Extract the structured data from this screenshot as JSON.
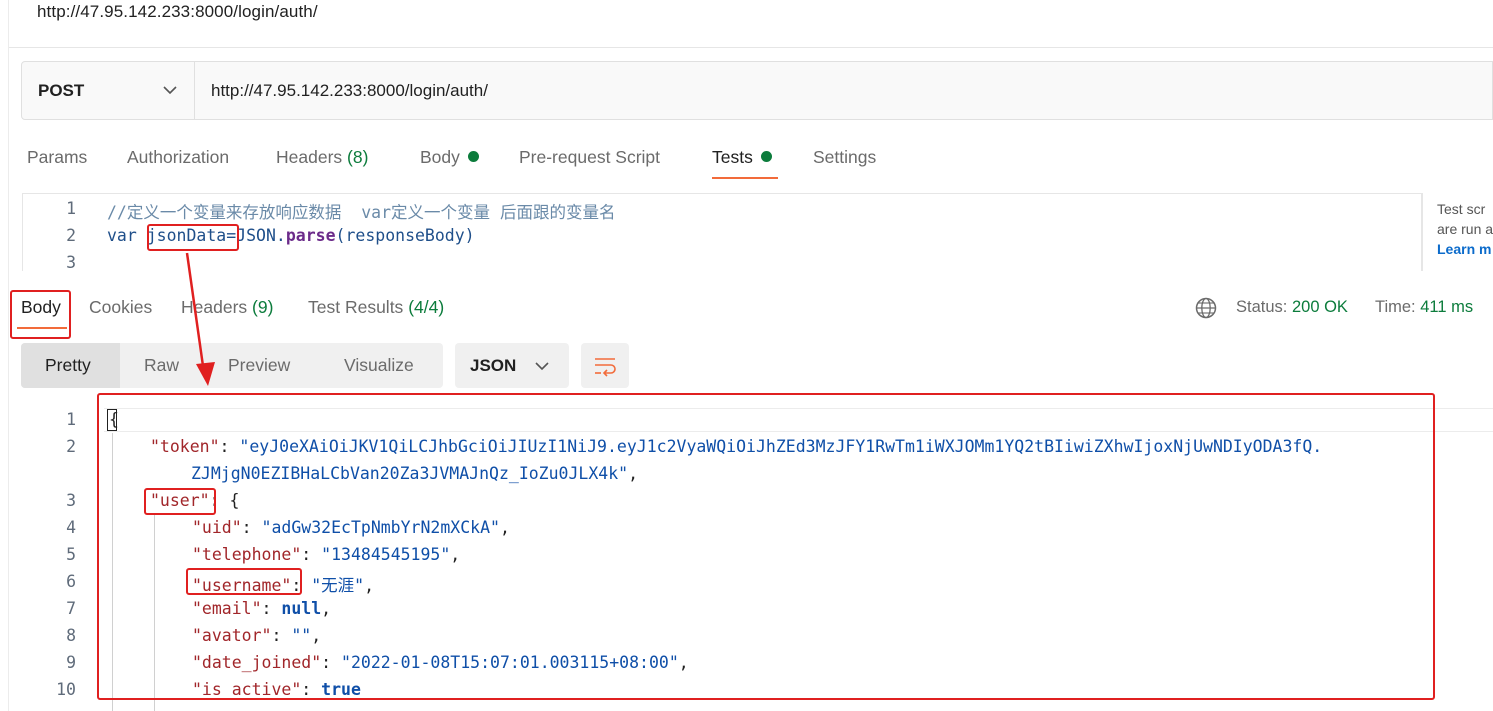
{
  "request": {
    "title": "http://47.95.142.233:8000/login/auth/",
    "method": "POST",
    "url": "http://47.95.142.233:8000/login/auth/"
  },
  "request_tabs": {
    "params": "Params",
    "authorization": "Authorization",
    "headers": "Headers",
    "headers_count": "(8)",
    "body": "Body",
    "pre_request": "Pre-request Script",
    "tests": "Tests",
    "settings": "Settings"
  },
  "script": {
    "line_numbers": [
      "1",
      "2",
      "3"
    ],
    "comment": "//定义一个变量来存放响应数据  var定义一个变量 后面跟的变量名",
    "var_kw": "var",
    "var_name": "jsonData",
    "eq": "=",
    "json_obj": "JSON",
    "dot": ".",
    "parse_fn": "parse",
    "args": "(responseBody)"
  },
  "side_hint": {
    "line1": "Test scr",
    "line2": "are run a",
    "link": "Learn m"
  },
  "response_tabs": {
    "body": "Body",
    "cookies": "Cookies",
    "headers": "Headers",
    "headers_count": "(9)",
    "test_results": "Test Results",
    "test_results_count": "(4/4)"
  },
  "status": {
    "status_label": "Status:",
    "status_value": "200 OK",
    "time_label": "Time:",
    "time_value": "411 ms"
  },
  "view_modes": {
    "pretty": "Pretty",
    "raw": "Raw",
    "preview": "Preview",
    "visualize": "Visualize",
    "format": "JSON"
  },
  "response": {
    "line_numbers": [
      "1",
      "2",
      "3",
      "4",
      "5",
      "6",
      "7",
      "8",
      "9",
      "10"
    ],
    "open_brace": "{",
    "token_key": "\"token\"",
    "token_value_1": "\"eyJ0eXAiOiJKV1QiLCJhbGciOiJIUzI1NiJ9.eyJ1c2VyaWQiOiJhZEd3MzJFY1RwTm1iWXJOMm1YQ2tBIiwiZXhwIjoxNjUwNDIyODA3fQ.",
    "token_value_2": "ZJMjgN0EZIBHaLCbVan20Za3JVMAJnQz_IoZu0JLX4k\"",
    "user_key": "\"user\"",
    "uid_key": "\"uid\"",
    "uid_value": "\"adGw32EcTpNmbYrN2mXCkA\"",
    "telephone_key": "\"telephone\"",
    "telephone_value": "\"13484545195\"",
    "username_key": "\"username\"",
    "username_value": "\"无涯\"",
    "email_key": "\"email\"",
    "email_value": "null",
    "avator_key": "\"avator\"",
    "avator_value": "\"\"",
    "date_joined_key": "\"date_joined\"",
    "date_joined_value": "\"2022-01-08T15:07:01.003115+08:00\"",
    "is_active_key": "\"is_active\"",
    "is_active_value": "true"
  },
  "colors": {
    "accent": "#f26b3a",
    "success": "#0c7c3c",
    "annotation": "#e02020"
  }
}
